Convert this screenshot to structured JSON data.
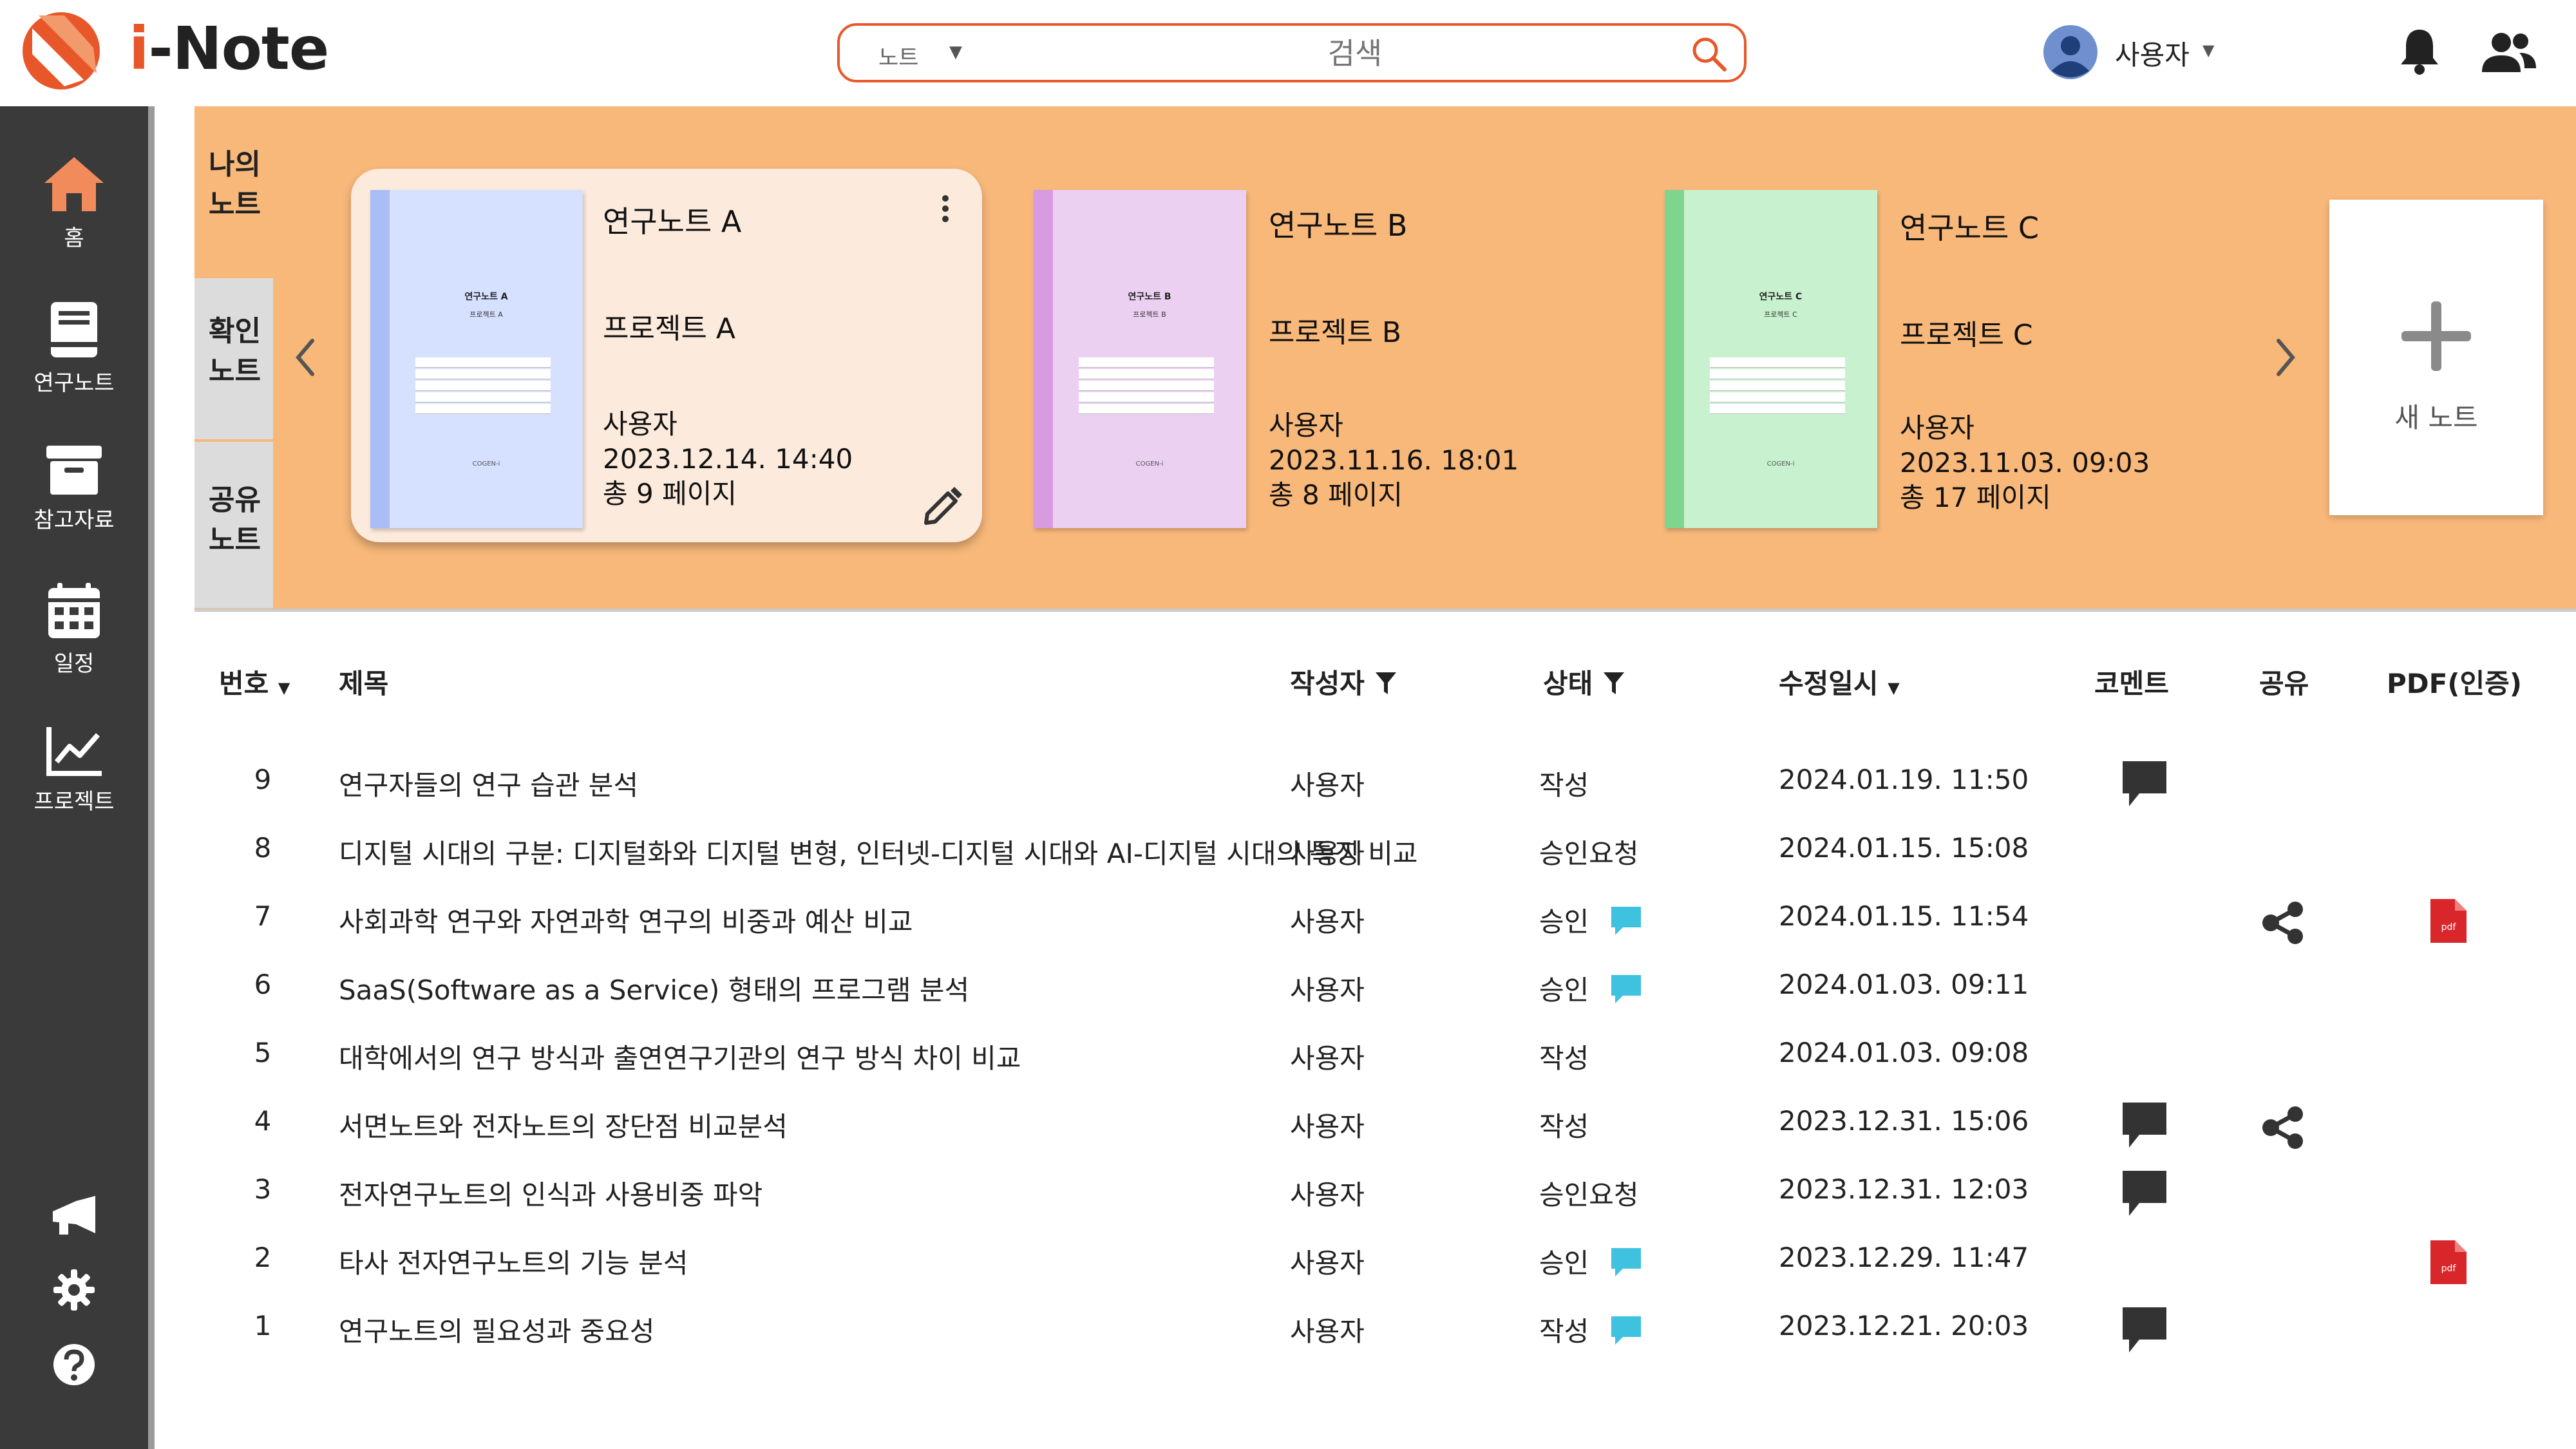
{
  "app": {
    "title_accent": "i",
    "title_rest": "-Note"
  },
  "search": {
    "scope": "노트",
    "placeholder": "검색"
  },
  "user": {
    "name": "사용자"
  },
  "sidebar": {
    "items": [
      {
        "label": "홈",
        "icon": "home-icon"
      },
      {
        "label": "연구노트",
        "icon": "notebook-icon"
      },
      {
        "label": "참고자료",
        "icon": "archive-icon"
      },
      {
        "label": "일정",
        "icon": "calendar-icon"
      },
      {
        "label": "프로젝트",
        "icon": "chart-icon"
      }
    ]
  },
  "note_tabs": [
    "나의 노트",
    "확인 노트",
    "공유 노트"
  ],
  "cards": [
    {
      "title": "연구노트 A",
      "project": "프로젝트 A",
      "author": "사용자",
      "date": "2023.12.14.  14:40",
      "pages": "총 9 페이지",
      "cover_title": "연구노트 A",
      "cover_sub": "프로젝트 A",
      "cover_brand": "COGEN-i"
    },
    {
      "title": "연구노트 B",
      "project": "프로젝트 B",
      "author": "사용자",
      "date": "2023.11.16.  18:01",
      "pages": "총 8 페이지",
      "cover_title": "연구노트 B",
      "cover_sub": "프로젝트 B",
      "cover_brand": "COGEN-i"
    },
    {
      "title": "연구노트 C",
      "project": "프로젝트 C",
      "author": "사용자",
      "date": "2023.11.03.  09:03",
      "pages": "총 17 페이지",
      "cover_title": "연구노트 C",
      "cover_sub": "프로젝트 C",
      "cover_brand": "COGEN-i"
    }
  ],
  "new_note": {
    "label": "새 노트"
  },
  "table": {
    "headers": {
      "num": "번호",
      "title": "제목",
      "author": "작성자",
      "status": "상태",
      "modified": "수정일시",
      "comment": "코멘트",
      "share": "공유",
      "pdf": "PDF(인증)"
    },
    "rows": [
      {
        "num": "9",
        "title": "연구자들의 연구 습관 분석",
        "author": "사용자",
        "status": "작성",
        "date": "2024.01.19. 11:50",
        "status_comment": false,
        "comment": true,
        "share": false,
        "pdf": false
      },
      {
        "num": "8",
        "title": "디지털 시대의 구분: 디지털화와 디지털 변형, 인터넷-디지털 시대와 AI-디지털 시대의 특징 비교",
        "author": "사용자",
        "status": "승인요청",
        "date": "2024.01.15. 15:08",
        "status_comment": false,
        "comment": false,
        "share": false,
        "pdf": false
      },
      {
        "num": "7",
        "title": "사회과학 연구와 자연과학 연구의 비중과 예산 비교",
        "author": "사용자",
        "status": "승인",
        "date": "2024.01.15. 11:54",
        "status_comment": true,
        "comment": false,
        "share": true,
        "pdf": true
      },
      {
        "num": "6",
        "title": "SaaS(Software as a Service) 형태의 프로그램 분석",
        "author": "사용자",
        "status": "승인",
        "date": "2024.01.03. 09:11",
        "status_comment": true,
        "comment": false,
        "share": false,
        "pdf": false
      },
      {
        "num": "5",
        "title": "대학에서의 연구 방식과 출연연구기관의 연구 방식 차이 비교",
        "author": "사용자",
        "status": "작성",
        "date": "2024.01.03. 09:08",
        "status_comment": false,
        "comment": false,
        "share": false,
        "pdf": false
      },
      {
        "num": "4",
        "title": "서면노트와 전자노트의 장단점 비교분석",
        "author": "사용자",
        "status": "작성",
        "date": "2023.12.31. 15:06",
        "status_comment": false,
        "comment": true,
        "share": true,
        "pdf": false
      },
      {
        "num": "3",
        "title": "전자연구노트의 인식과 사용비중 파악",
        "author": "사용자",
        "status": "승인요청",
        "date": "2023.12.31. 12:03",
        "status_comment": false,
        "comment": true,
        "share": false,
        "pdf": false
      },
      {
        "num": "2",
        "title": "타사 전자연구노트의 기능 분석",
        "author": "사용자",
        "status": "승인",
        "date": "2023.12.29. 11:47",
        "status_comment": true,
        "comment": false,
        "share": false,
        "pdf": true
      },
      {
        "num": "1",
        "title": "연구노트의 필요성과 중요성",
        "author": "사용자",
        "status": "작성",
        "date": "2023.12.21. 20:03",
        "status_comment": true,
        "comment": true,
        "share": false,
        "pdf": false
      }
    ]
  },
  "colors": {
    "accent": "#e8572a",
    "banner": "#f8b87a",
    "sidebar": "#3a3a3a",
    "status_comment": "#3fc2df",
    "pdf": "#d9262b"
  }
}
